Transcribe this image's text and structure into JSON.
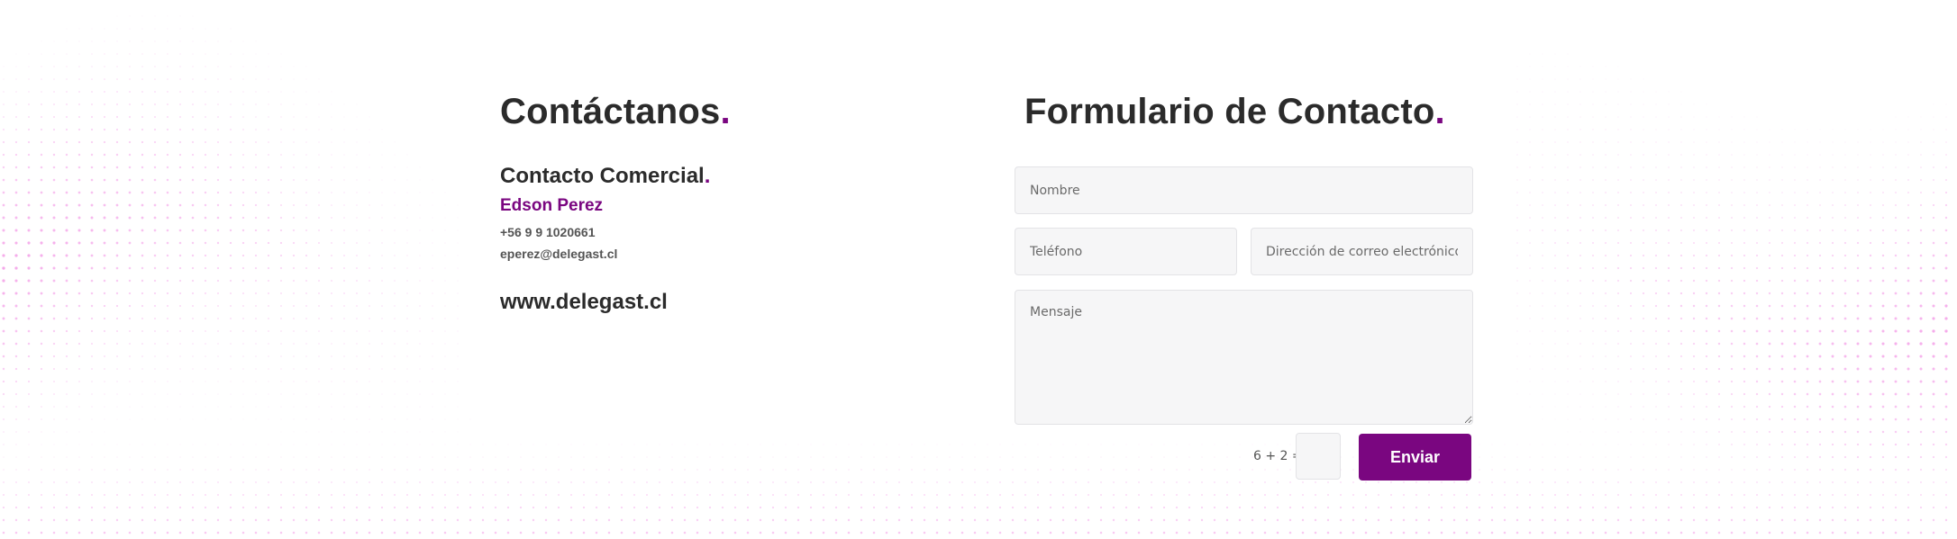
{
  "colors": {
    "accent": "#7a0680",
    "heading": "#2b2b2b",
    "field_bg": "#f6f6f7",
    "dots": "#f07ee0"
  },
  "left": {
    "title": "Contáctanos",
    "title_dot": ".",
    "commercial": {
      "title": "Contacto Comercial",
      "dot": "."
    },
    "name": "Edson Perez",
    "phone": "+56 9 9 1020661",
    "email": "eperez@delegast.cl",
    "website": "www.delegast.cl"
  },
  "form": {
    "title": "Formulario de Contacto",
    "title_dot": ".",
    "name_placeholder": "Nombre",
    "phone_placeholder": "Teléfono",
    "email_placeholder": "Dirección de correo electrónico",
    "message_placeholder": "Mensaje",
    "captcha_label": "6 + 2 =",
    "captcha_value": "",
    "submit_label": "Enviar"
  }
}
